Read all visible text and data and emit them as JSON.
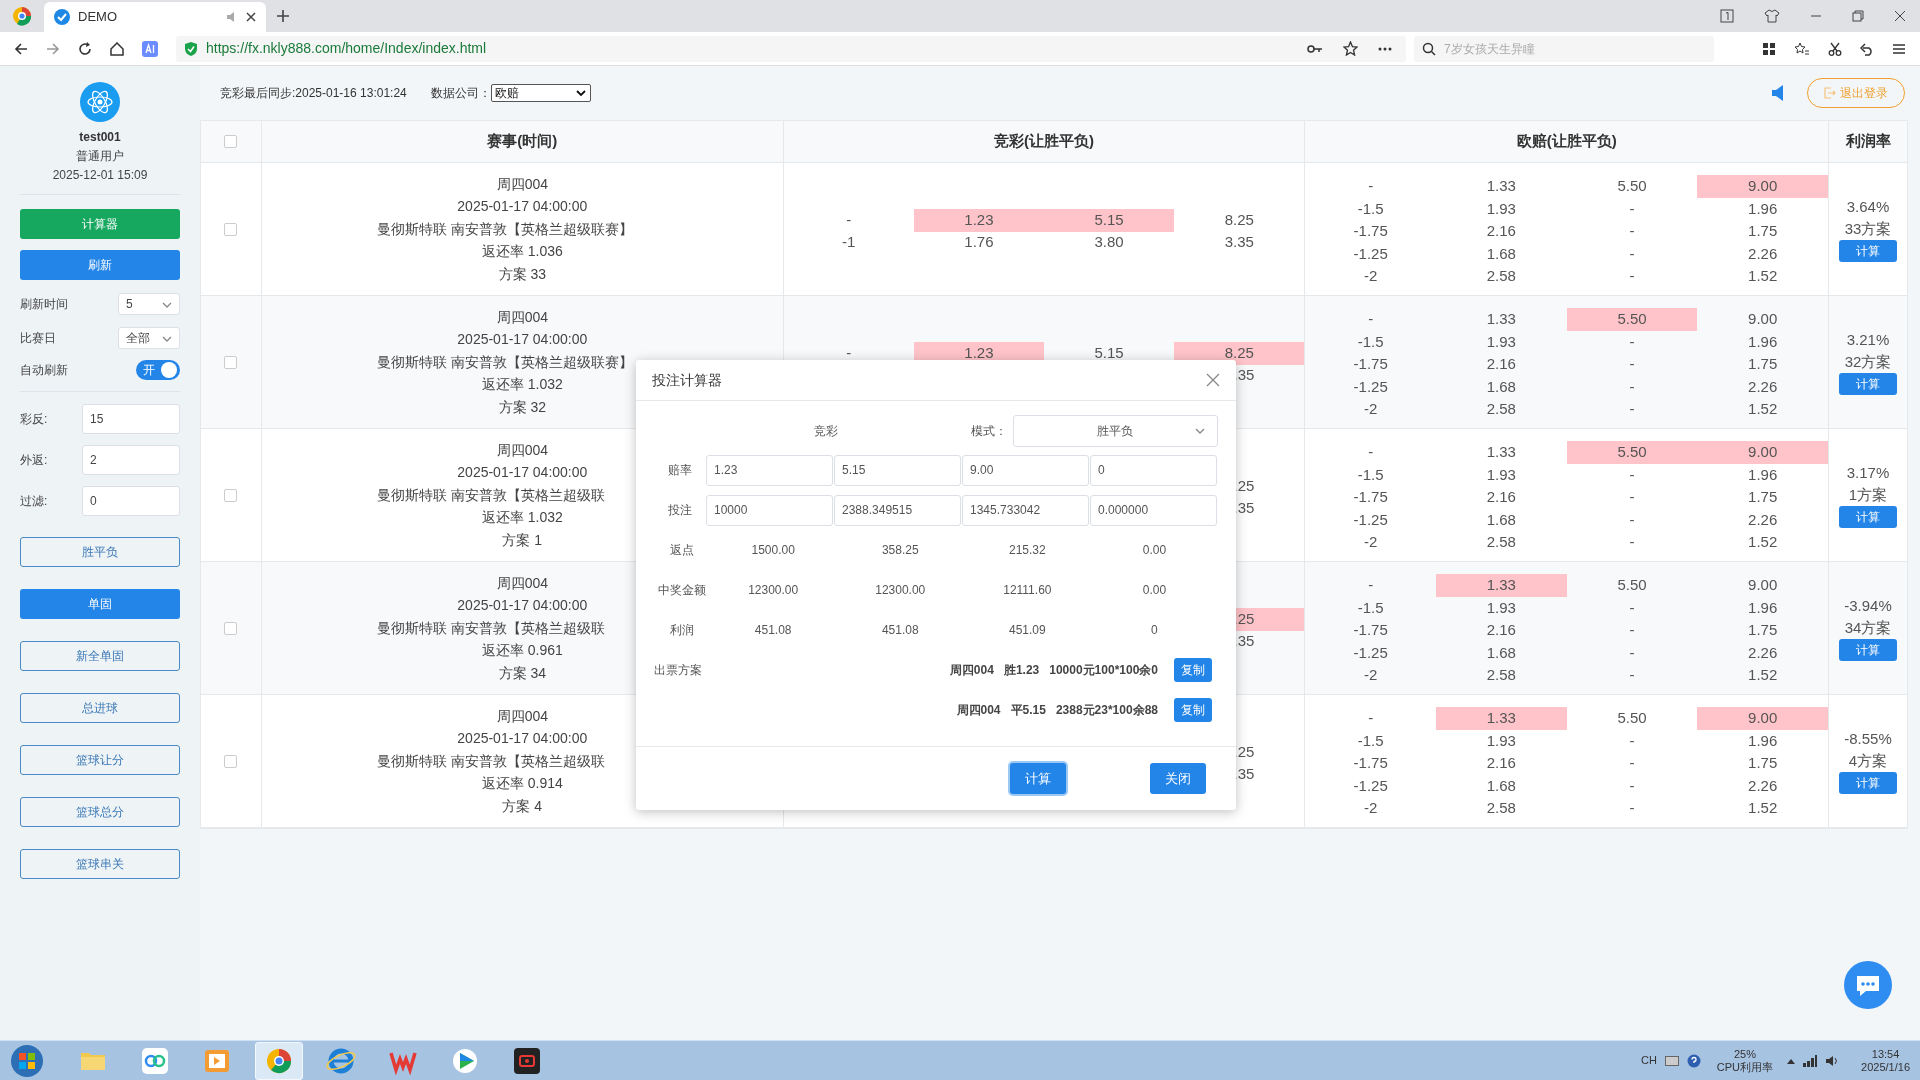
{
  "browser": {
    "tab": {
      "title": "DEMO",
      "selected": true
    },
    "url": "https://fx.nkly888.com/home/Index/index.html",
    "search": {
      "placeholder": "7岁女孩天生异瞳"
    }
  },
  "user": {
    "name": "test001",
    "role": "普通用户",
    "date": "2025-12-01 15:09"
  },
  "sidebar": {
    "calculator_button": "计算器",
    "refresh_button": "刷新",
    "selects": [
      {
        "label": "刷新时间",
        "value": "5"
      },
      {
        "label": "比赛日",
        "value": "全部"
      }
    ],
    "auto_refresh": {
      "label": "自动刷新",
      "text": "开",
      "on": true
    },
    "filters": [
      {
        "label": "彩反:",
        "value": "15"
      },
      {
        "label": "外返:",
        "value": "2"
      },
      {
        "label": "过滤:",
        "value": "0"
      }
    ],
    "modes": [
      {
        "label": "胜平负",
        "selected": false
      },
      {
        "label": "单固",
        "selected": true
      },
      {
        "label": "新全单固",
        "selected": false
      },
      {
        "label": "总进球",
        "selected": false
      },
      {
        "label": "篮球让分",
        "selected": false
      },
      {
        "label": "篮球总分",
        "selected": false
      },
      {
        "label": "篮球串关",
        "selected": false
      }
    ]
  },
  "toolbar": {
    "sync": "竞彩最后同步:2025-01-16 13:01:24",
    "company_label": "数据公司：",
    "company": "欧赔",
    "logout": "退出登录"
  },
  "table": {
    "select_all_checked": false,
    "columns": [
      "赛事(时间)",
      "竞彩(让胜平负)",
      "欧赔(让胜平负)",
      "利润率"
    ],
    "rows": [
      {
        "checked": false,
        "event": [
          "周四004",
          "2025-01-17 04:00:00",
          "曼彻斯特联 南安普敦【英格兰超级联赛】",
          "返还率 1.036",
          "方案 33"
        ],
        "jingcai": [
          {
            "values": [
              "-",
              "1.23",
              "5.15",
              "8.25"
            ],
            "highlighted": [
              false,
              true,
              true,
              false
            ]
          },
          {
            "values": [
              "-1",
              "1.76",
              "3.80",
              "3.35"
            ],
            "highlighted": [
              false,
              false,
              false,
              false
            ]
          }
        ],
        "euro": [
          {
            "values": [
              "-",
              "1.33",
              "5.50",
              "9.00"
            ],
            "highlighted": [
              false,
              false,
              false,
              true
            ]
          },
          {
            "values": [
              "-1.5",
              "1.93",
              "-",
              "1.96"
            ],
            "highlighted": [
              false,
              false,
              false,
              false
            ]
          },
          {
            "values": [
              "-1.75",
              "2.16",
              "-",
              "1.75"
            ],
            "highlighted": [
              false,
              false,
              false,
              false
            ]
          },
          {
            "values": [
              "-1.25",
              "1.68",
              "-",
              "2.26"
            ],
            "highlighted": [
              false,
              false,
              false,
              false
            ]
          },
          {
            "values": [
              "-2",
              "2.58",
              "-",
              "1.52"
            ],
            "highlighted": [
              false,
              false,
              false,
              false
            ]
          }
        ],
        "profit": "3.64%",
        "plans": "33方案",
        "action": "计算"
      },
      {
        "checked": false,
        "event": [
          "周四004",
          "2025-01-17 04:00:00",
          "曼彻斯特联 南安普敦【英格兰超级联赛】",
          "返还率 1.032",
          "方案 32"
        ],
        "jingcai": [
          {
            "values": [
              "-",
              "1.23",
              "5.15",
              "8.25"
            ],
            "highlighted": [
              false,
              true,
              false,
              true
            ]
          },
          {
            "values": [
              ".35"
            ],
            "highlighted": [
              false
            ]
          }
        ],
        "euro": [
          {
            "values": [
              "-",
              "1.33",
              "5.50",
              "9.00"
            ],
            "highlighted": [
              false,
              false,
              true,
              false
            ]
          },
          {
            "values": [
              "-1.5",
              "1.93",
              "-",
              "1.96"
            ],
            "highlighted": [
              false,
              false,
              false,
              false
            ]
          },
          {
            "values": [
              "-1.75",
              "2.16",
              "-",
              "1.75"
            ],
            "highlighted": [
              false,
              false,
              false,
              false
            ]
          },
          {
            "values": [
              "-1.25",
              "1.68",
              "-",
              "2.26"
            ],
            "highlighted": [
              false,
              false,
              false,
              false
            ]
          },
          {
            "values": [
              "-2",
              "2.58",
              "-",
              "1.52"
            ],
            "highlighted": [
              false,
              false,
              false,
              false
            ]
          }
        ],
        "profit": "3.21%",
        "plans": "32方案",
        "action": "计算"
      },
      {
        "checked": false,
        "event": [
          "周四004",
          "2025-01-17 04:00:00",
          "曼彻斯特联 南安普敦【英格兰超级联",
          "返还率 1.032",
          "方案 1"
        ],
        "jingcai": [
          {
            "values": [
              ".25"
            ],
            "highlighted": [
              false
            ]
          },
          {
            "values": [
              ".35"
            ],
            "highlighted": [
              false
            ]
          }
        ],
        "euro": [
          {
            "values": [
              "-",
              "1.33",
              "5.50",
              "9.00"
            ],
            "highlighted": [
              false,
              false,
              true,
              true
            ]
          },
          {
            "values": [
              "-1.5",
              "1.93",
              "-",
              "1.96"
            ],
            "highlighted": [
              false,
              false,
              false,
              false
            ]
          },
          {
            "values": [
              "-1.75",
              "2.16",
              "-",
              "1.75"
            ],
            "highlighted": [
              false,
              false,
              false,
              false
            ]
          },
          {
            "values": [
              "-1.25",
              "1.68",
              "-",
              "2.26"
            ],
            "highlighted": [
              false,
              false,
              false,
              false
            ]
          },
          {
            "values": [
              "-2",
              "2.58",
              "-",
              "1.52"
            ],
            "highlighted": [
              false,
              false,
              false,
              false
            ]
          }
        ],
        "profit": "3.17%",
        "plans": "1方案",
        "action": "计算"
      },
      {
        "checked": false,
        "event": [
          "周四004",
          "2025-01-17 04:00:00",
          "曼彻斯特联 南安普敦【英格兰超级联",
          "返还率 0.961",
          "方案 34"
        ],
        "jingcai": [
          {
            "values": [
              ".25"
            ],
            "highlighted": [
              true
            ]
          },
          {
            "values": [
              ".35"
            ],
            "highlighted": [
              false
            ]
          }
        ],
        "euro": [
          {
            "values": [
              "-",
              "1.33",
              "5.50",
              "9.00"
            ],
            "highlighted": [
              false,
              true,
              false,
              false
            ]
          },
          {
            "values": [
              "-1.5",
              "1.93",
              "-",
              "1.96"
            ],
            "highlighted": [
              false,
              false,
              false,
              false
            ]
          },
          {
            "values": [
              "-1.75",
              "2.16",
              "-",
              "1.75"
            ],
            "highlighted": [
              false,
              false,
              false,
              false
            ]
          },
          {
            "values": [
              "-1.25",
              "1.68",
              "-",
              "2.26"
            ],
            "highlighted": [
              false,
              false,
              false,
              false
            ]
          },
          {
            "values": [
              "-2",
              "2.58",
              "-",
              "1.52"
            ],
            "highlighted": [
              false,
              false,
              false,
              false
            ]
          }
        ],
        "profit": "-3.94%",
        "plans": "34方案",
        "action": "计算"
      },
      {
        "checked": false,
        "event": [
          "周四004",
          "2025-01-17 04:00:00",
          "曼彻斯特联 南安普敦【英格兰超级联",
          "返还率 0.914",
          "方案 4"
        ],
        "jingcai": [
          {
            "values": [
              ".25"
            ],
            "highlighted": [
              false
            ]
          },
          {
            "values": [
              ".35"
            ],
            "highlighted": [
              false
            ]
          }
        ],
        "euro": [
          {
            "values": [
              "-",
              "1.33",
              "5.50",
              "9.00"
            ],
            "highlighted": [
              false,
              true,
              false,
              true
            ]
          },
          {
            "values": [
              "-1.5",
              "1.93",
              "-",
              "1.96"
            ],
            "highlighted": [
              false,
              false,
              false,
              false
            ]
          },
          {
            "values": [
              "-1.75",
              "2.16",
              "-",
              "1.75"
            ],
            "highlighted": [
              false,
              false,
              false,
              false
            ]
          },
          {
            "values": [
              "-1.25",
              "1.68",
              "-",
              "2.26"
            ],
            "highlighted": [
              false,
              false,
              false,
              false
            ]
          },
          {
            "values": [
              "-2",
              "2.58",
              "-",
              "1.52"
            ],
            "highlighted": [
              false,
              false,
              false,
              false
            ]
          }
        ],
        "profit": "-8.55%",
        "plans": "4方案",
        "action": "计算"
      }
    ]
  },
  "calculator": {
    "title": "投注计算器",
    "source_label": "竞彩",
    "mode_label": "模式：",
    "mode": "胜平负",
    "rows": [
      {
        "label": "赔率",
        "kind": "input",
        "values": [
          "1.23",
          "5.15",
          "9.00",
          "0"
        ]
      },
      {
        "label": "投注",
        "kind": "input",
        "values": [
          "10000",
          "2388.349515",
          "1345.733042",
          "0.000000"
        ]
      },
      {
        "label": "返点",
        "kind": "text",
        "values": [
          "1500.00",
          "358.25",
          "215.32",
          "0.00"
        ]
      },
      {
        "label": "中奖金额",
        "kind": "text",
        "values": [
          "12300.00",
          "12300.00",
          "12111.60",
          "0.00"
        ]
      },
      {
        "label": "利润",
        "kind": "text",
        "values": [
          "451.08",
          "451.08",
          "451.09",
          "0"
        ]
      }
    ],
    "plan_label": "出票方案",
    "plans": [
      {
        "match": "周四004",
        "pick": "胜1.23",
        "detail": "10000元100*100余0",
        "action": "复制"
      },
      {
        "match": "周四004",
        "pick": "平5.15",
        "detail": "2388元23*100余88",
        "action": "复制"
      }
    ],
    "buttons": [
      {
        "label": "计算",
        "focused": true
      },
      {
        "label": "关闭",
        "focused": false
      }
    ]
  },
  "taskbar": {
    "apps": [
      {
        "kind": "folder",
        "active": false
      },
      {
        "kind": "cloud",
        "active": false
      },
      {
        "kind": "player",
        "active": false
      },
      {
        "kind": "browser",
        "active": true
      },
      {
        "kind": "ie",
        "active": false
      },
      {
        "kind": "office",
        "active": false
      },
      {
        "kind": "video",
        "active": false
      },
      {
        "kind": "recorder",
        "active": false
      }
    ],
    "input_lang": "CH",
    "cpu_percent": "25%",
    "cpu_label": "CPU利用率",
    "time": "13:54",
    "date": "2025/1/16"
  }
}
